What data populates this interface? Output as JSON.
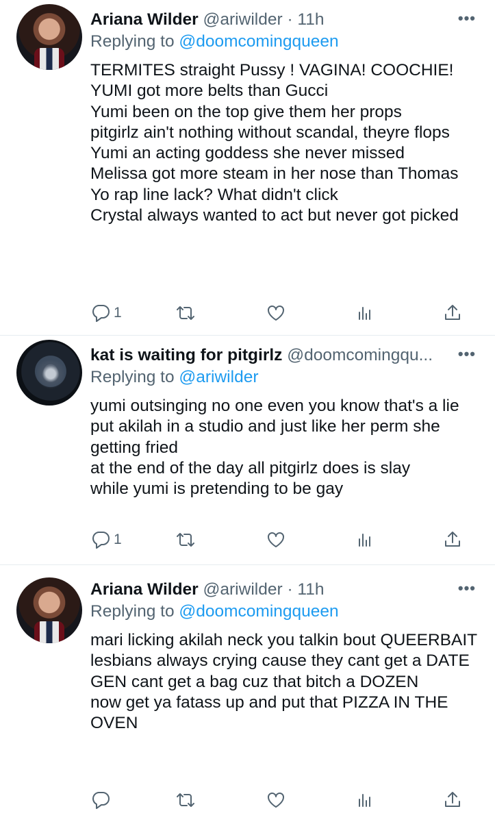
{
  "tweets": [
    {
      "name": "Ariana Wilder",
      "handle": "@ariwilder",
      "dot": "·",
      "time": "11h",
      "replying_prefix": "Replying to",
      "replying_to": "@doomcomingqueen",
      "lines": [
        "TERMITES straight Pussy ! VAGINA! COOCHIE!",
        "YUMI got more belts than Gucci",
        "Yumi been on the top give them her props",
        "pitgirlz ain't nothing without scandal, theyre flops",
        "Yumi an acting goddess she never missed",
        "Melissa got more steam in her nose than Thomas",
        "Yo rap line lack? What didn't click",
        "Crystal always wanted to act but never got picked"
      ],
      "reply_count": "1",
      "icons": {
        "more": "more-icon",
        "reply": "reply-icon",
        "retweet": "retweet-icon",
        "like": "heart-icon",
        "stats": "analytics-icon",
        "share": "share-icon"
      }
    },
    {
      "name": "kat is waiting for pitgirlz",
      "handle": "@doomcomingqu...",
      "dot": "",
      "time": "",
      "replying_prefix": "Replying to",
      "replying_to": "@ariwilder",
      "lines": [
        "yumi outsinging no one even you know that's a lie",
        "put akilah in a studio and just like her perm she getting fried",
        "at the end of the day all pitgirlz does is slay",
        "while yumi is pretending to be gay"
      ],
      "reply_count": "1",
      "icons": {
        "more": "more-icon",
        "reply": "reply-icon",
        "retweet": "retweet-icon",
        "like": "heart-icon",
        "stats": "analytics-icon",
        "share": "share-icon"
      }
    },
    {
      "name": "Ariana Wilder",
      "handle": "@ariwilder",
      "dot": "·",
      "time": "11h",
      "replying_prefix": "Replying to",
      "replying_to": "@doomcomingqueen",
      "lines": [
        "mari licking akilah neck you talkin bout QUEERBAIT",
        "lesbians always crying cause they cant get a DATE",
        "GEN cant get a bag cuz that bitch a DOZEN",
        "now get ya fatass up and put that PIZZA IN THE OVEN"
      ],
      "reply_count": "",
      "icons": {
        "more": "more-icon",
        "reply": "reply-icon",
        "retweet": "retweet-icon",
        "like": "heart-icon",
        "stats": "analytics-icon",
        "share": "share-icon"
      }
    }
  ],
  "colors": {
    "text": "#0f1419",
    "secondary": "#536471",
    "link": "#1d9bf0",
    "divider": "#e6ecf0"
  }
}
